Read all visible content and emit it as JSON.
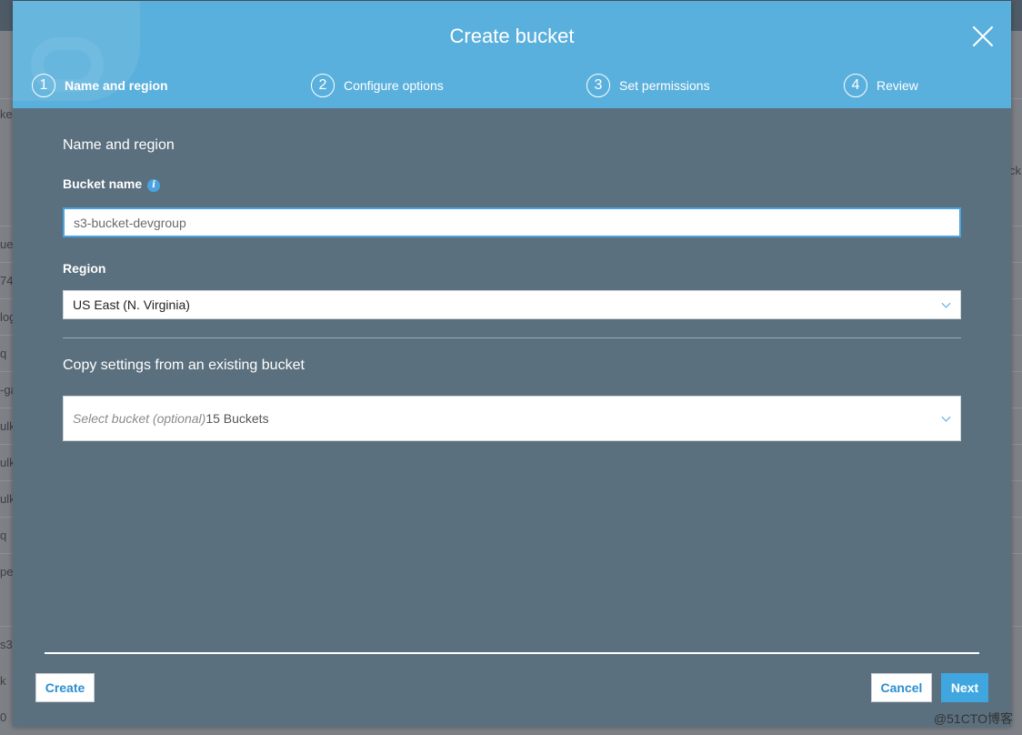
{
  "background": {
    "left_fragments": [
      "ke",
      "ue",
      "74",
      "log",
      "q",
      "-ga",
      "ulk",
      "ulk",
      "ulk",
      "q",
      "per",
      "s3",
      "k",
      "0"
    ],
    "right_fragments": [
      "ck"
    ]
  },
  "modal": {
    "title": "Create bucket",
    "steps": [
      {
        "number": "1",
        "label": "Name and region",
        "active": true
      },
      {
        "number": "2",
        "label": "Configure options",
        "active": false
      },
      {
        "number": "3",
        "label": "Set permissions",
        "active": false
      },
      {
        "number": "4",
        "label": "Review",
        "active": false
      }
    ],
    "section_title": "Name and region",
    "bucket_name": {
      "label": "Bucket name",
      "info_icon": "i",
      "value": "s3-bucket-devgroup"
    },
    "region": {
      "label": "Region",
      "selected": "US East (N. Virginia)"
    },
    "copy_settings": {
      "title": "Copy settings from an existing bucket",
      "placeholder": "Select bucket (optional)",
      "count": "15 Buckets"
    },
    "buttons": {
      "create": "Create",
      "cancel": "Cancel",
      "next": "Next"
    }
  },
  "watermark": "@51CTO博客",
  "colors": {
    "header": "#5ab0dc",
    "body": "#5b707e",
    "accent": "#3fa6e0"
  }
}
